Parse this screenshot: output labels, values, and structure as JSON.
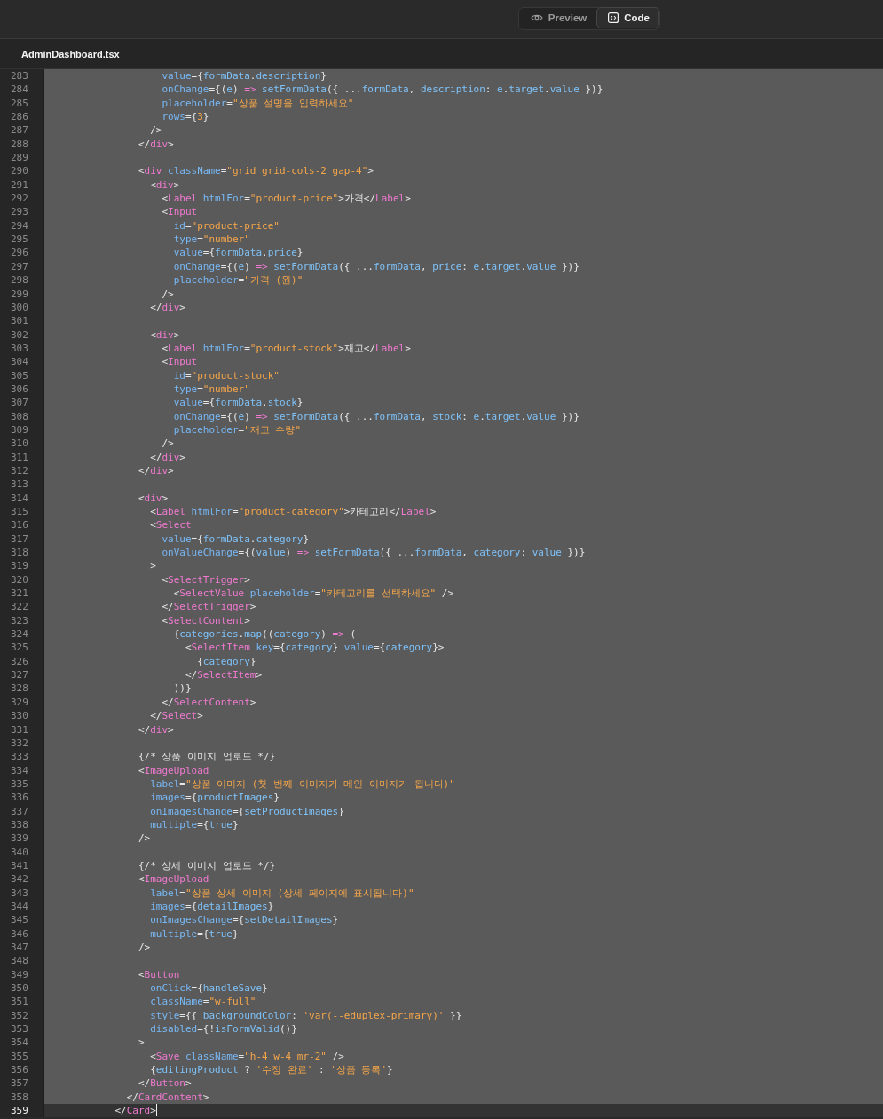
{
  "view_toggle": [
    {
      "kind": "preview",
      "label": "Preview",
      "selected": false
    },
    {
      "kind": "code",
      "label": "Code",
      "selected": true
    }
  ],
  "file_tab": {
    "label": "AdminDashboard.tsx",
    "selected": true
  },
  "editor": {
    "lines": [
      {
        "number": "283",
        "code": "                    value={formData.description}",
        "selected": true,
        "current": false
      },
      {
        "number": "284",
        "code": "                    onChange={(e) => setFormData({ ...formData, description: e.target.value })}",
        "selected": true,
        "current": false
      },
      {
        "number": "285",
        "code": "                    placeholder=\"상품 설명을 입력하세요\"",
        "selected": true,
        "current": false
      },
      {
        "number": "286",
        "code": "                    rows={3}",
        "selected": true,
        "current": false
      },
      {
        "number": "287",
        "code": "                  />",
        "selected": true,
        "current": false
      },
      {
        "number": "288",
        "code": "                </div>",
        "selected": true,
        "current": false
      },
      {
        "number": "289",
        "selected": true,
        "current": false
      },
      {
        "number": "290",
        "code": "                <div className=\"grid grid-cols-2 gap-4\">",
        "selected": true,
        "current": false
      },
      {
        "number": "291",
        "code": "                  <div>",
        "selected": true,
        "current": false
      },
      {
        "number": "292",
        "code": "                    <Label htmlFor=\"product-price\">가격</Label>",
        "selected": true,
        "current": false
      },
      {
        "number": "293",
        "code": "                    <Input",
        "selected": true,
        "current": false
      },
      {
        "number": "294",
        "code": "                      id=\"product-price\"",
        "selected": true,
        "current": false
      },
      {
        "number": "295",
        "code": "                      type=\"number\"",
        "selected": true,
        "current": false
      },
      {
        "number": "296",
        "code": "                      value={formData.price}",
        "selected": true,
        "current": false
      },
      {
        "number": "297",
        "code": "                      onChange={(e) => setFormData({ ...formData, price: e.target.value })}",
        "selected": true,
        "current": false
      },
      {
        "number": "298",
        "code": "                      placeholder=\"가격 (원)\"",
        "selected": true,
        "current": false
      },
      {
        "number": "299",
        "code": "                    />",
        "selected": true,
        "current": false
      },
      {
        "number": "300",
        "code": "                  </div>",
        "selected": true,
        "current": false
      },
      {
        "number": "301",
        "selected": true,
        "current": false
      },
      {
        "number": "302",
        "code": "                  <div>",
        "selected": true,
        "current": false
      },
      {
        "number": "303",
        "code": "                    <Label htmlFor=\"product-stock\">재고</Label>",
        "selected": true,
        "current": false
      },
      {
        "number": "304",
        "code": "                    <Input",
        "selected": true,
        "current": false
      },
      {
        "number": "305",
        "code": "                      id=\"product-stock\"",
        "selected": true,
        "current": false
      },
      {
        "number": "306",
        "code": "                      type=\"number\"",
        "selected": true,
        "current": false
      },
      {
        "number": "307",
        "code": "                      value={formData.stock}",
        "selected": true,
        "current": false
      },
      {
        "number": "308",
        "code": "                      onChange={(e) => setFormData({ ...formData, stock: e.target.value })}",
        "selected": true,
        "current": false
      },
      {
        "number": "309",
        "code": "                      placeholder=\"재고 수량\"",
        "selected": true,
        "current": false
      },
      {
        "number": "310",
        "code": "                    />",
        "selected": true,
        "current": false
      },
      {
        "number": "311",
        "code": "                  </div>",
        "selected": true,
        "current": false
      },
      {
        "number": "312",
        "code": "                </div>",
        "selected": true,
        "current": false
      },
      {
        "number": "313",
        "selected": true,
        "current": false
      },
      {
        "number": "314",
        "code": "                <div>",
        "selected": true,
        "current": false
      },
      {
        "number": "315",
        "code": "                  <Label htmlFor=\"product-category\">카테고리</Label>",
        "selected": true,
        "current": false
      },
      {
        "number": "316",
        "code": "                  <Select",
        "selected": true,
        "current": false
      },
      {
        "number": "317",
        "code": "                    value={formData.category}",
        "selected": true,
        "current": false
      },
      {
        "number": "318",
        "code": "                    onValueChange={(value) => setFormData({ ...formData, category: value })}",
        "selected": true,
        "current": false
      },
      {
        "number": "319",
        "code": "                  >",
        "selected": true,
        "current": false
      },
      {
        "number": "320",
        "code": "                    <SelectTrigger>",
        "selected": true,
        "current": false
      },
      {
        "number": "321",
        "code": "                      <SelectValue placeholder=\"카테고리를 선택하세요\" />",
        "selected": true,
        "current": false
      },
      {
        "number": "322",
        "code": "                    </SelectTrigger>",
        "selected": true,
        "current": false
      },
      {
        "number": "323",
        "code": "                    <SelectContent>",
        "selected": true,
        "current": false
      },
      {
        "number": "324",
        "code": "                      {categories.map((category) => (",
        "selected": true,
        "current": false
      },
      {
        "number": "325",
        "code": "                        <SelectItem key={category} value={category}>",
        "selected": true,
        "current": false
      },
      {
        "number": "326",
        "code": "                          {category}",
        "selected": true,
        "current": false
      },
      {
        "number": "327",
        "code": "                        </SelectItem>",
        "selected": true,
        "current": false
      },
      {
        "number": "328",
        "code": "                      ))}",
        "selected": true,
        "current": false
      },
      {
        "number": "329",
        "code": "                    </SelectContent>",
        "selected": true,
        "current": false
      },
      {
        "number": "330",
        "code": "                  </Select>",
        "selected": true,
        "current": false
      },
      {
        "number": "331",
        "code": "                </div>",
        "selected": true,
        "current": false
      },
      {
        "number": "332",
        "selected": true,
        "current": false
      },
      {
        "number": "333",
        "code": "                {/* 상품 이미지 업로드 */}",
        "selected": true,
        "current": false
      },
      {
        "number": "334",
        "code": "                <ImageUpload",
        "selected": true,
        "current": false
      },
      {
        "number": "335",
        "code": "                  label=\"상품 이미지 (첫 번째 이미지가 메인 이미지가 됩니다)\"",
        "selected": true,
        "current": false
      },
      {
        "number": "336",
        "code": "                  images={productImages}",
        "selected": true,
        "current": false
      },
      {
        "number": "337",
        "code": "                  onImagesChange={setProductImages}",
        "selected": true,
        "current": false
      },
      {
        "number": "338",
        "code": "                  multiple={true}",
        "selected": true,
        "current": false
      },
      {
        "number": "339",
        "code": "                />",
        "selected": true,
        "current": false
      },
      {
        "number": "340",
        "selected": true,
        "current": false
      },
      {
        "number": "341",
        "code": "                {/* 상세 이미지 업로드 */}",
        "selected": true,
        "current": false
      },
      {
        "number": "342",
        "code": "                <ImageUpload",
        "selected": true,
        "current": false
      },
      {
        "number": "343",
        "code": "                  label=\"상품 상세 이미지 (상세 페이지에 표시됩니다)\"",
        "selected": true,
        "current": false
      },
      {
        "number": "344",
        "code": "                  images={detailImages}",
        "selected": true,
        "current": false
      },
      {
        "number": "345",
        "code": "                  onImagesChange={setDetailImages}",
        "selected": true,
        "current": false
      },
      {
        "number": "346",
        "code": "                  multiple={true}",
        "selected": true,
        "current": false
      },
      {
        "number": "347",
        "code": "                />",
        "selected": true,
        "current": false
      },
      {
        "number": "348",
        "selected": true,
        "current": false
      },
      {
        "number": "349",
        "code": "                <Button",
        "selected": true,
        "current": false
      },
      {
        "number": "350",
        "code": "                  onClick={handleSave}",
        "selected": true,
        "current": false
      },
      {
        "number": "351",
        "code": "                  className=\"w-full\"",
        "selected": true,
        "current": false
      },
      {
        "number": "352",
        "code": "                  style={{ backgroundColor: 'var(--eduplex-primary)' }}",
        "selected": true,
        "current": false
      },
      {
        "number": "353",
        "code": "                  disabled={!isFormValid()}",
        "selected": true,
        "current": false
      },
      {
        "number": "354",
        "code": "                >",
        "selected": true,
        "current": false
      },
      {
        "number": "355",
        "code": "                  <Save className=\"h-4 w-4 mr-2\" />",
        "selected": true,
        "current": false
      },
      {
        "number": "356",
        "code": "                  {editingProduct ? '수정 완료' : '상품 등록'}",
        "selected": true,
        "current": false
      },
      {
        "number": "357",
        "code": "                </Button>",
        "selected": true,
        "current": false
      },
      {
        "number": "358",
        "code": "              </CardContent>",
        "selected": true,
        "current": false
      },
      {
        "number": "359",
        "code": "            </Card>",
        "selected": false,
        "current": true
      }
    ]
  }
}
